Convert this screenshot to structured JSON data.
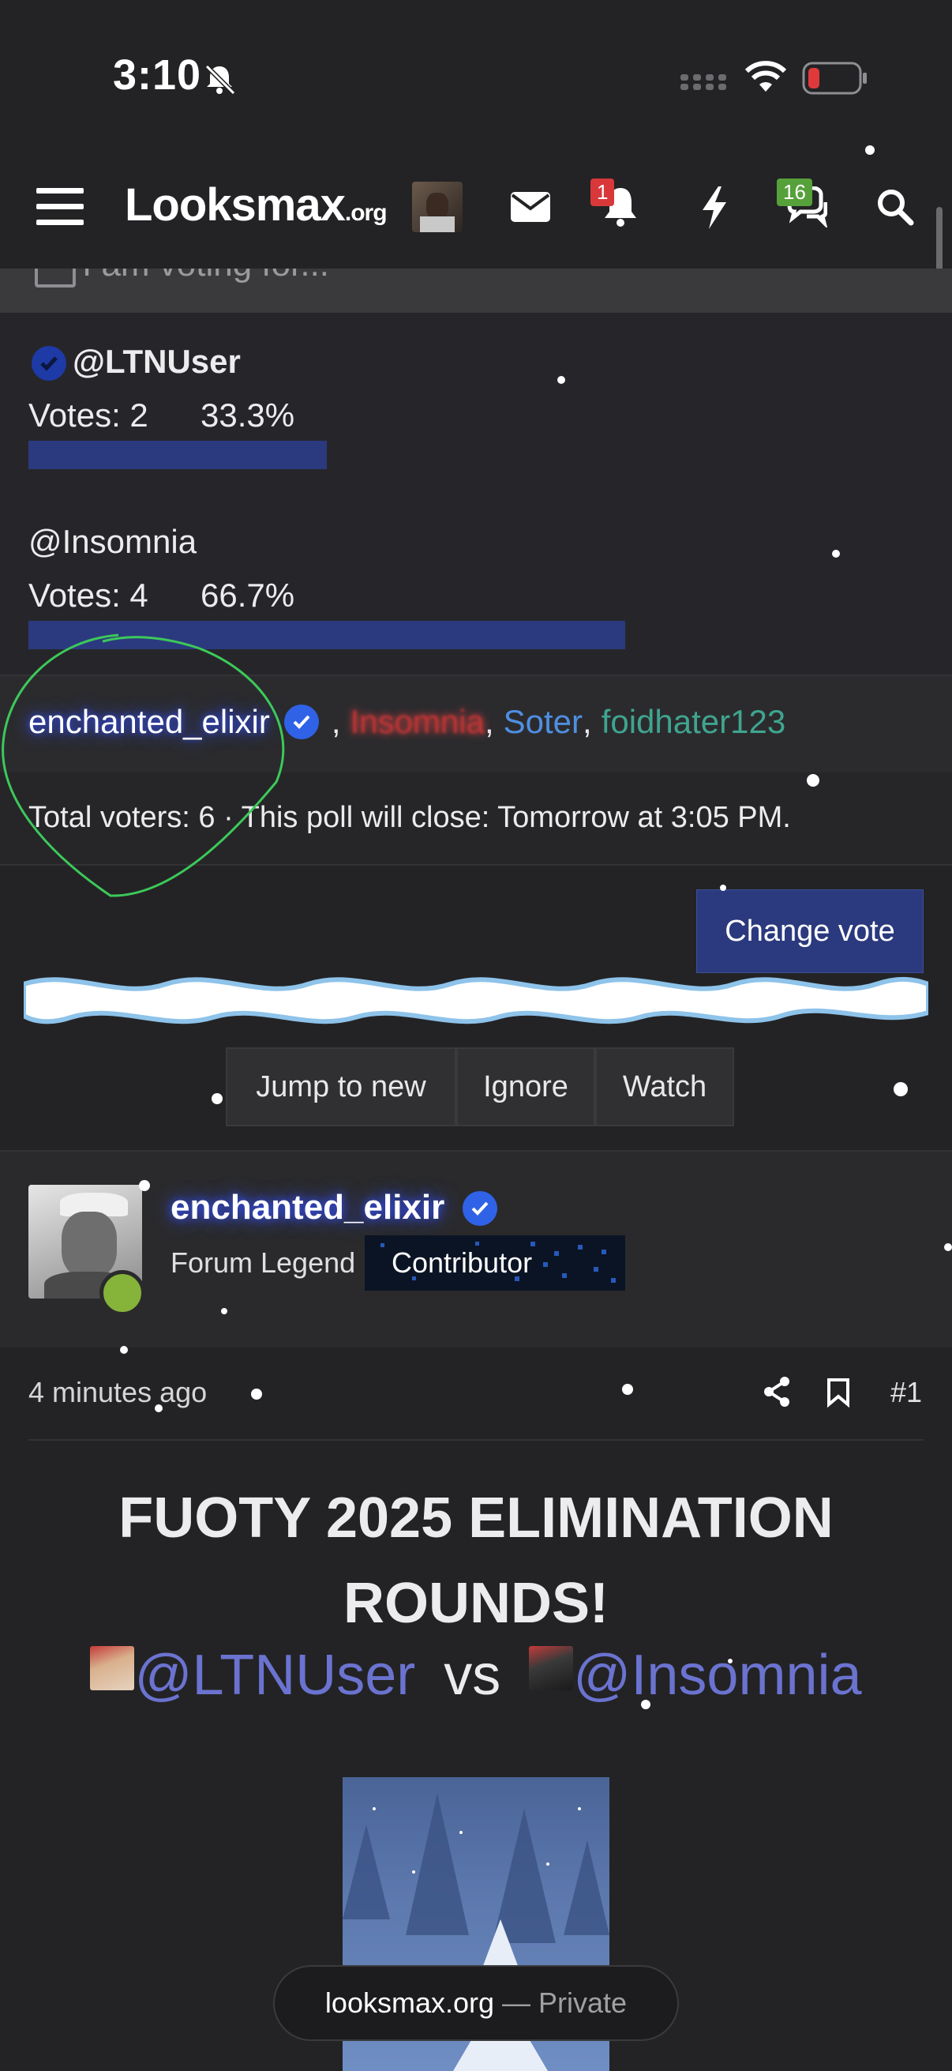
{
  "status_bar": {
    "time": "3:10"
  },
  "nav": {
    "logo_main": "Looksmax",
    "logo_suffix": ".org",
    "alerts_badge": "1",
    "conversations_badge": "16"
  },
  "poll": {
    "cutoff_header": "I am voting for...",
    "options": [
      {
        "name": "@LTNUser",
        "votes_label": "Votes: 2",
        "percent_label": "33.3%",
        "fraction": 0.333
      },
      {
        "name": "@Insomnia",
        "votes_label": "Votes: 4",
        "percent_label": "66.7%",
        "fraction": 0.667
      }
    ],
    "voters": [
      "enchanted_elixir",
      "Insomnia",
      "Soter",
      "foidhater123"
    ],
    "separator": ",",
    "total_line": "Total voters: 6 · This poll will close: Tomorrow at 3:05 PM.",
    "change_vote": "Change vote"
  },
  "thread_actions": {
    "jump_to_new": "Jump to new",
    "ignore": "Ignore",
    "watch": "Watch"
  },
  "post": {
    "author": "enchanted_elixir",
    "rank": "Forum Legend",
    "banner": "Contributor",
    "time_ago": "4 minutes ago",
    "post_number": "#1",
    "headline": "FUOTY 2025 ELIMINATION ROUNDS!",
    "mention_a": "@LTNUser",
    "versus": "vs",
    "mention_b": "@Insomnia"
  },
  "browser": {
    "domain": "looksmax.org",
    "mode": "— Private"
  },
  "colors": {
    "background": "#232325",
    "bar": "#2b3a7e",
    "mention": "#6b73d0",
    "soter": "#4f8fe0",
    "foidhater": "#3fa58f",
    "insomnia": "#c03535",
    "online": "#86b33a"
  }
}
